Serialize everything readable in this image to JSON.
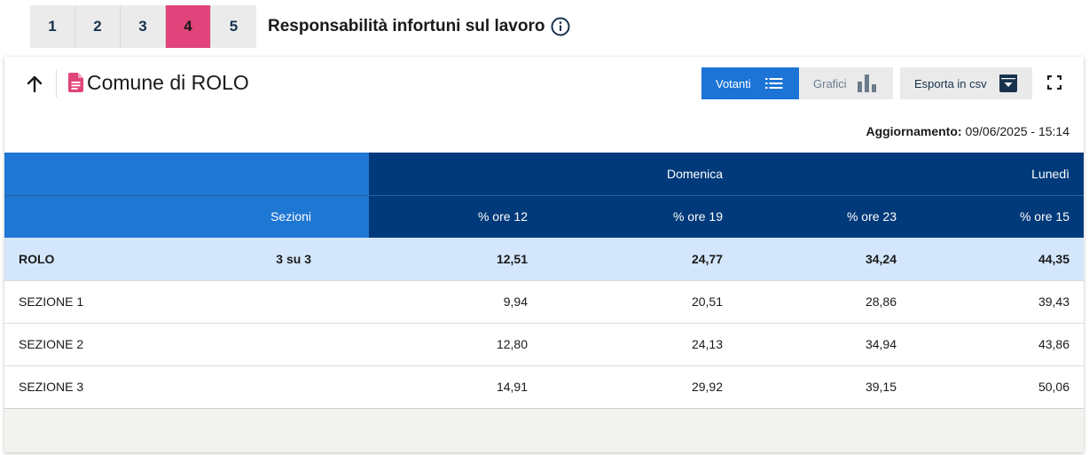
{
  "steps": [
    "1",
    "2",
    "3",
    "4",
    "5"
  ],
  "active_step": "4",
  "topic": "Responsabilità infortuni sul lavoro",
  "card": {
    "title": "Comune di ROLO",
    "votanti_label": "Votanti",
    "grafici_label": "Grafici",
    "csv_label": "Esporta in csv",
    "updated_label": "Aggiornamento:",
    "updated_value": "09/06/2025 - 15:14"
  },
  "table": {
    "day1": "Domenica",
    "day2": "Lunedì",
    "sezioni_header": "Sezioni",
    "columns": [
      "% ore 12",
      "% ore 19",
      "% ore 23",
      "% ore 15"
    ],
    "total": {
      "name": "ROLO",
      "sezioni": "3 su 3",
      "values": [
        "12,51",
        "24,77",
        "34,24",
        "44,35"
      ]
    },
    "rows": [
      {
        "name": "SEZIONE 1",
        "values": [
          "9,94",
          "20,51",
          "28,86",
          "39,43"
        ]
      },
      {
        "name": "SEZIONE 2",
        "values": [
          "12,80",
          "24,13",
          "34,94",
          "43,86"
        ]
      },
      {
        "name": "SEZIONE 3",
        "values": [
          "14,91",
          "29,92",
          "39,15",
          "50,06"
        ]
      }
    ]
  },
  "colors": {
    "accent_pink": "#e0447a",
    "primary_blue": "#1b74d6",
    "dark_blue": "#003a7a",
    "total_row": "#d3e6fb"
  },
  "icons": [
    "info-icon",
    "arrow-up-icon",
    "document-icon",
    "list-icon",
    "bar-chart-icon",
    "download-icon",
    "fullscreen-icon"
  ]
}
